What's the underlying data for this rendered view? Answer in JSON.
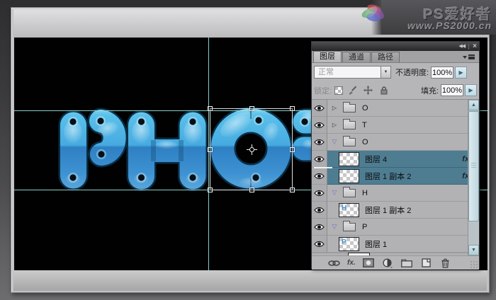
{
  "watermark": {
    "brand": "PS爱好者",
    "url": "www.PS2000.cn"
  },
  "canvas": {
    "visible_letters": "PHOT"
  },
  "panel": {
    "tabs": [
      {
        "label": "图层",
        "active": true
      },
      {
        "label": "通道",
        "active": false
      },
      {
        "label": "路径",
        "active": false
      }
    ],
    "blend_mode_value": "正常",
    "opacity_label": "不透明度:",
    "opacity_value": "100%",
    "lock_label": "锁定:",
    "fill_label": "填充:",
    "fill_value": "100%",
    "layers": [
      {
        "type": "group",
        "name": "O",
        "state": "collapsed",
        "selected": false
      },
      {
        "type": "group",
        "name": "T",
        "state": "collapsed",
        "selected": false
      },
      {
        "type": "group",
        "name": "O",
        "state": "expanded",
        "selected": false
      },
      {
        "type": "layer",
        "name": "图层 4",
        "selected": true,
        "has_fx": true,
        "thumb_glyph": ""
      },
      {
        "type": "layer",
        "name": "图层 1 副本 2",
        "selected": true,
        "has_fx": true,
        "thumb_glyph": ""
      },
      {
        "type": "group",
        "name": "H",
        "state": "expanded",
        "selected": false
      },
      {
        "type": "layer",
        "name": "图层 1 副本 2",
        "selected": false,
        "has_fx": false,
        "thumb_glyph": "H"
      },
      {
        "type": "group",
        "name": "P",
        "state": "expanded",
        "selected": false
      },
      {
        "type": "layer",
        "name": "图层 1",
        "selected": false,
        "has_fx": false,
        "thumb_glyph": "P"
      }
    ]
  },
  "icons": {
    "panel_collapse": "◀◀",
    "panel_close": "×",
    "group_collapsed": "▷",
    "group_expanded": "▽",
    "dropdown_arrow": "▼",
    "spinner_arrow": "▶",
    "scroll_up": "▲",
    "scroll_down": "▼",
    "fx_badge": "fx",
    "layer_option_caret": "▼"
  },
  "colors": {
    "selected_layer_row": "#4e7d92",
    "guide_cyan": "#98e6de",
    "letter_blue_top": "#55bce8",
    "letter_blue_bottom": "#2f85c8",
    "canvas_background": "#010102"
  }
}
